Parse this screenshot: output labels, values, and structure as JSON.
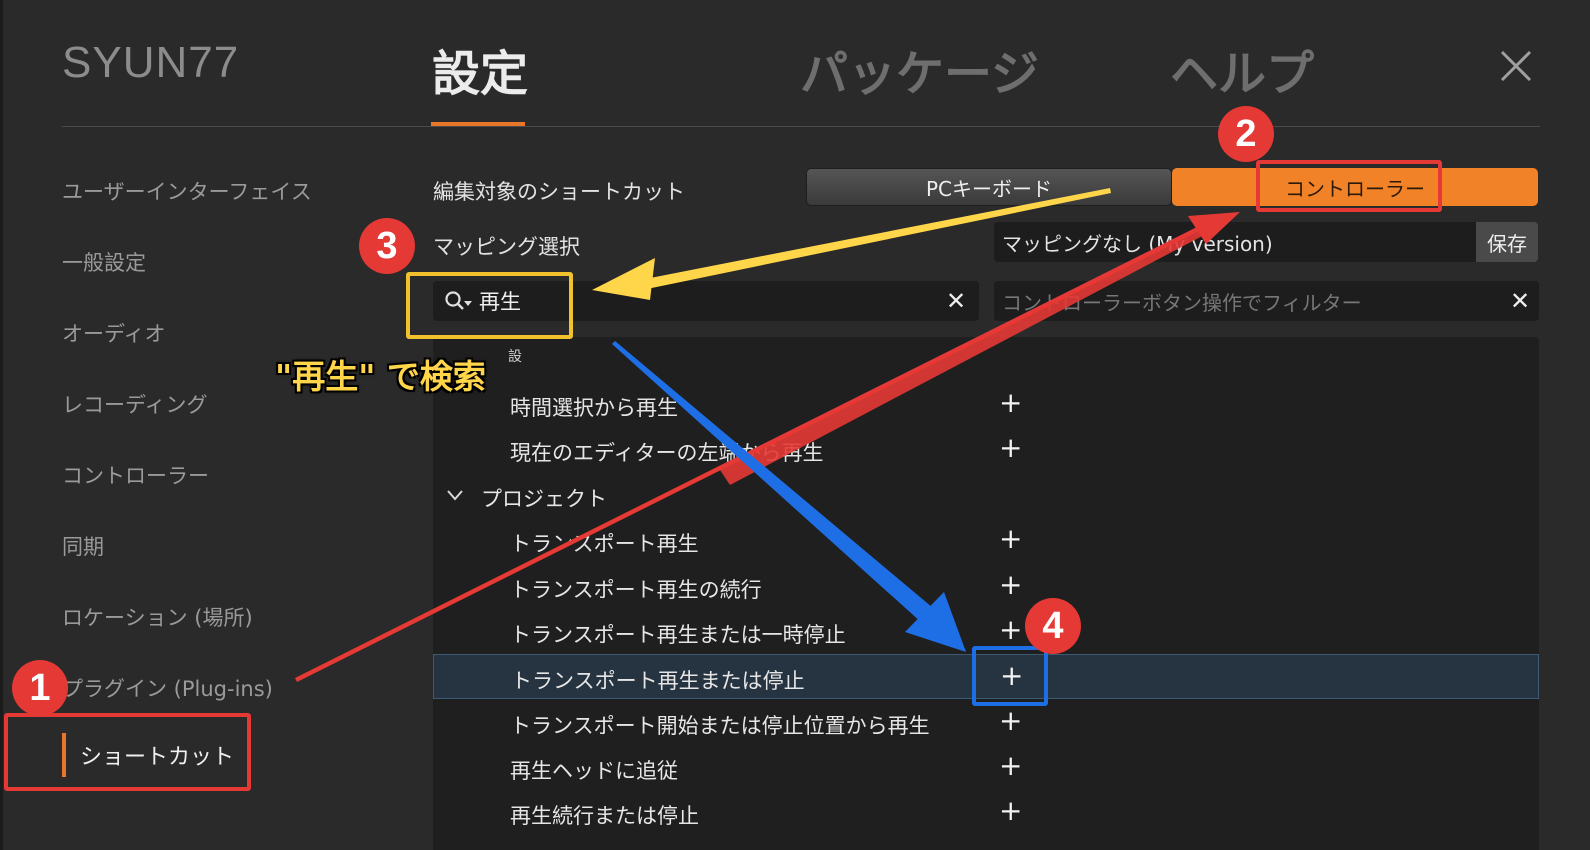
{
  "brand": "SYUN77",
  "tabs": [
    {
      "label": "設定"
    },
    {
      "label": "パッケージ"
    },
    {
      "label": "ヘルプ"
    }
  ],
  "sidebar": {
    "items": [
      {
        "label": "ユーザーインターフェイス"
      },
      {
        "label": "一般設定"
      },
      {
        "label": "オーディオ"
      },
      {
        "label": "レコーディング"
      },
      {
        "label": "コントローラー"
      },
      {
        "label": "同期"
      },
      {
        "label": "ロケーション (場所)"
      },
      {
        "label": "プラグイン (Plug-ins)"
      }
    ],
    "active": "ショートカット"
  },
  "shortcuts": {
    "edit_target_label": "編集対象のショートカット",
    "seg_pc": "PCキーボード",
    "seg_controller": "コントローラー",
    "mapping_label": "マッピング選択",
    "mapping_value": "マッピングなし (My version)",
    "save": "保存",
    "search_value": "再生",
    "filter_placeholder": "コントローラーボタン操作でフィルター",
    "clear": "✕"
  },
  "list": {
    "partial_label": "設",
    "rows": [
      {
        "name": "時間選択から再生",
        "plus": "+"
      },
      {
        "name": "現在のエディターの左端から再生",
        "plus": "+"
      },
      {
        "name": "プロジェクト",
        "group": true
      },
      {
        "name": "トランスポート再生",
        "plus": "+"
      },
      {
        "name": "トランスポート再生の続行",
        "plus": "+"
      },
      {
        "name": "トランスポート再生または一時停止",
        "plus": "+"
      },
      {
        "name": "トランスポート再生または停止",
        "plus": "+",
        "selected": true
      },
      {
        "name": "トランスポート開始または停止位置から再生",
        "plus": "+"
      },
      {
        "name": "再生ヘッドに追従",
        "plus": "+"
      },
      {
        "name": "再生続行または停止",
        "plus": "+"
      }
    ]
  },
  "annotations": {
    "badges": [
      "1",
      "2",
      "3",
      "4"
    ],
    "caption": "\"再生\" で検索",
    "colors": {
      "red": "#e53935",
      "yellow": "#ffd54a",
      "blue": "#1e6fe6",
      "accent": "#e8772a"
    }
  }
}
